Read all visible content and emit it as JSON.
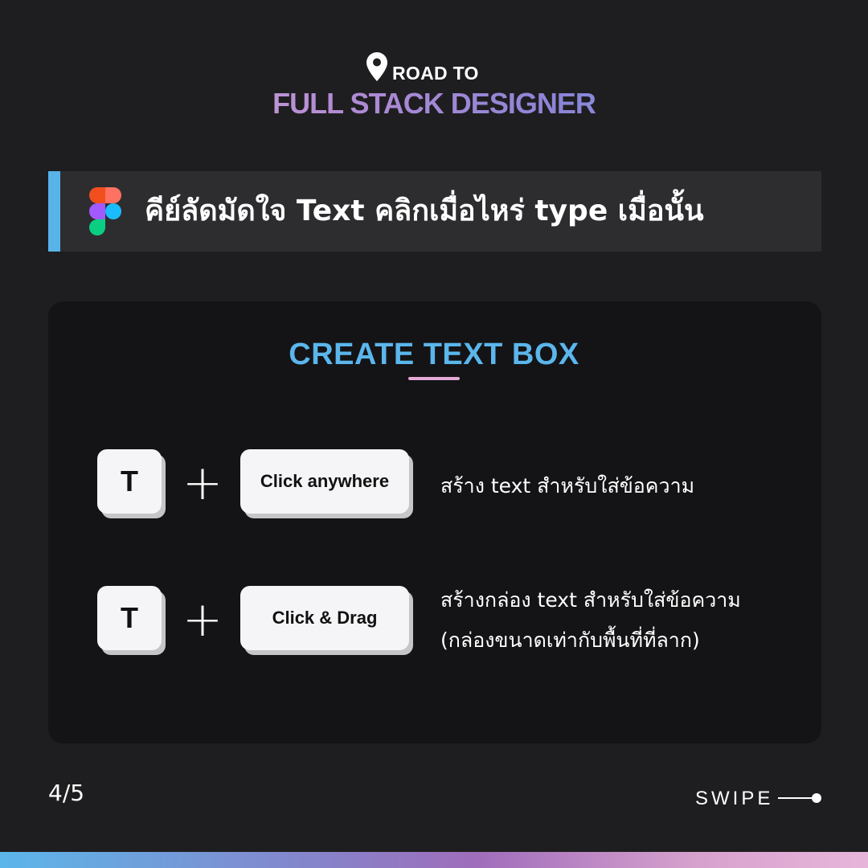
{
  "brand": {
    "top_line": "ROAD TO",
    "main_line": "FULL STACK DESIGNER",
    "pin_icon": "map-pin-icon"
  },
  "header": {
    "title": "คีย์ลัดมัดใจ Text คลิกเมื่อไหร่ type เมื่อนั้น",
    "icon": "figma-icon",
    "accent_color": "#58b3e8"
  },
  "card": {
    "title": "CREATE TEXT BOX",
    "title_color": "#5bb6ec",
    "shortcuts": [
      {
        "key": "T",
        "plus": "+",
        "action": "Click anywhere",
        "description": [
          "สร้าง text สำหรับใส่ข้อความ"
        ]
      },
      {
        "key": "T",
        "plus": "+",
        "action": "Click & Drag",
        "description": [
          "สร้างกล่อง text สำหรับใส่ข้อความ",
          "(กล่องขนาดเท่ากับพื้นที่ที่ลาก)"
        ]
      }
    ]
  },
  "footer": {
    "page": "4/5",
    "swipe": "SWIPE"
  }
}
